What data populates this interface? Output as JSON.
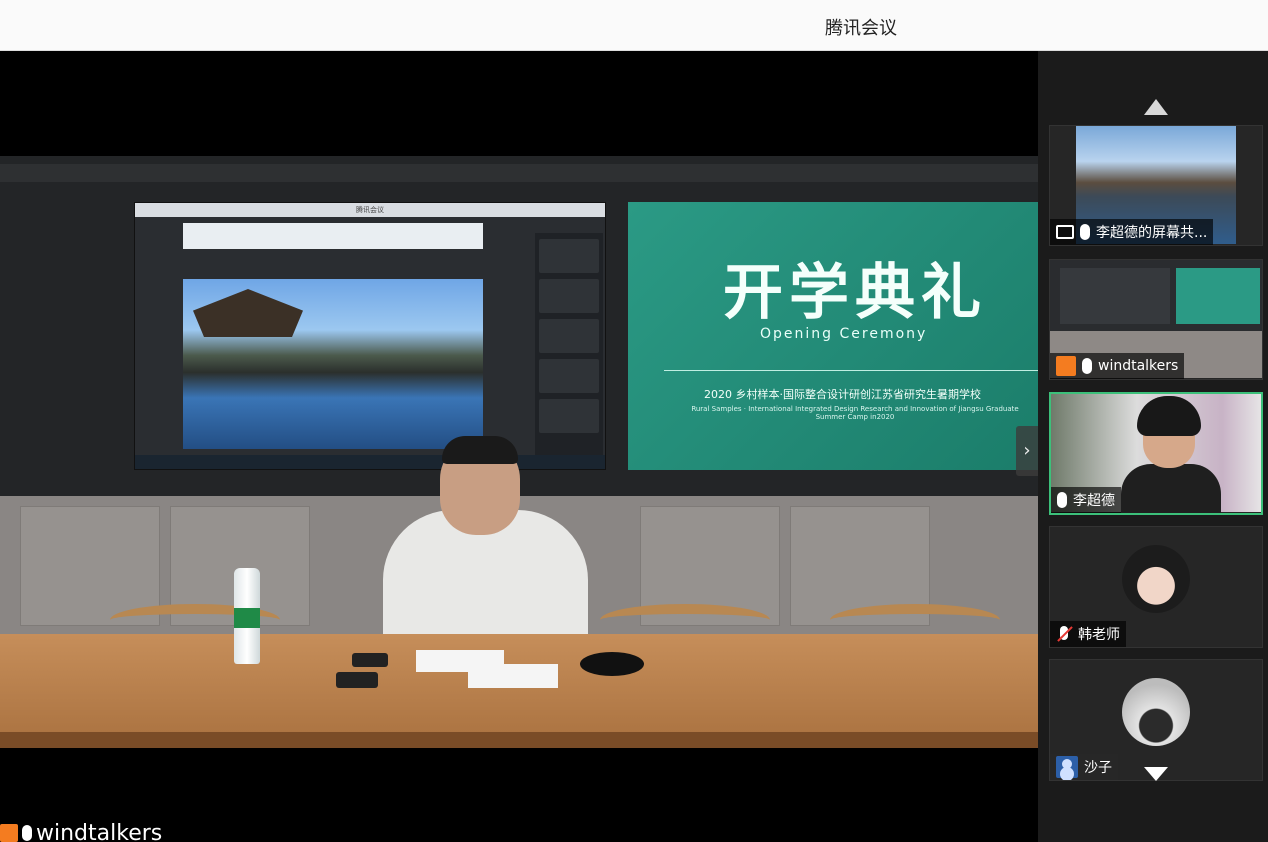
{
  "window": {
    "title": "腾讯会议"
  },
  "main_stage": {
    "speaker_name": "windtalkers",
    "slide": {
      "title_cn": "开学典礼",
      "title_en": "Opening Ceremony",
      "subtitle_cn": "2020 乡村样本·国际整合设计研创江苏省研究生暑期学校",
      "subtitle_en": "Rural Samples · International Integrated Design Research and Innovation of Jiangsu Graduate Summer Camp in2020"
    },
    "left_screen_window_title": "腾讯会议"
  },
  "participants": [
    {
      "name": "李超德的屏幕共...",
      "type": "screen-share",
      "mic": "on"
    },
    {
      "name": "windtalkers",
      "type": "video",
      "mic": "on",
      "icon": "camera-icon"
    },
    {
      "name": "李超德",
      "type": "video",
      "mic": "on",
      "active": true
    },
    {
      "name": "韩老师",
      "type": "avatar",
      "mic": "muted"
    },
    {
      "name": "沙子",
      "type": "avatar",
      "mic": "none",
      "icon": "user-icon"
    }
  ],
  "colors": {
    "active_border": "#3cc07a",
    "camera_orange": "#f47c20",
    "slide_teal": "#2b9a85"
  }
}
